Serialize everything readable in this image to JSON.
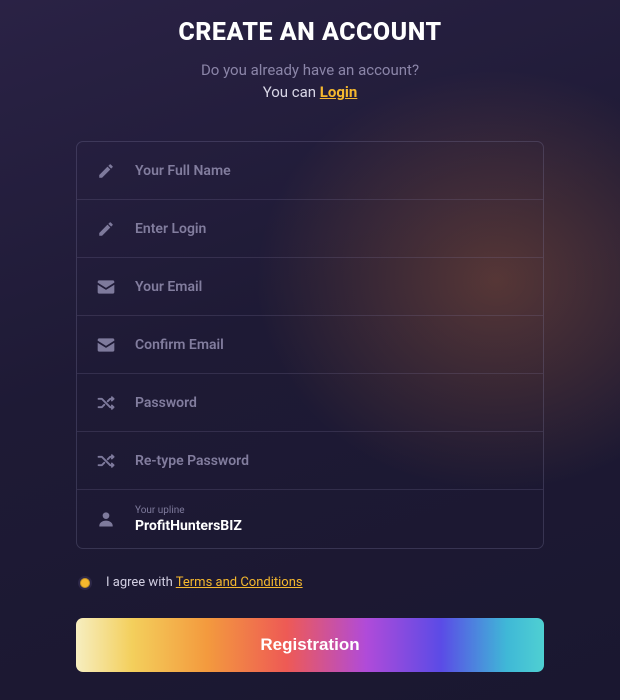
{
  "header": {
    "title": "CREATE AN ACCOUNT",
    "subtitle": "Do you already have an account?",
    "you_can": "You can ",
    "login_link": "Login"
  },
  "fields": {
    "fullname": {
      "placeholder": "Your Full Name",
      "value": ""
    },
    "login": {
      "placeholder": "Enter Login",
      "value": ""
    },
    "email": {
      "placeholder": "Your Email",
      "value": ""
    },
    "email2": {
      "placeholder": "Confirm Email",
      "value": ""
    },
    "password": {
      "placeholder": "Password",
      "value": ""
    },
    "password2": {
      "placeholder": "Re-type Password",
      "value": ""
    },
    "upline": {
      "label": "Your upline",
      "value": "ProfitHuntersBIZ"
    }
  },
  "agree": {
    "prefix": "I agree with ",
    "terms_link": "Terms and Conditions",
    "checked": true
  },
  "submit": {
    "label": "Registration"
  },
  "colors": {
    "accent": "#f5b82e"
  }
}
